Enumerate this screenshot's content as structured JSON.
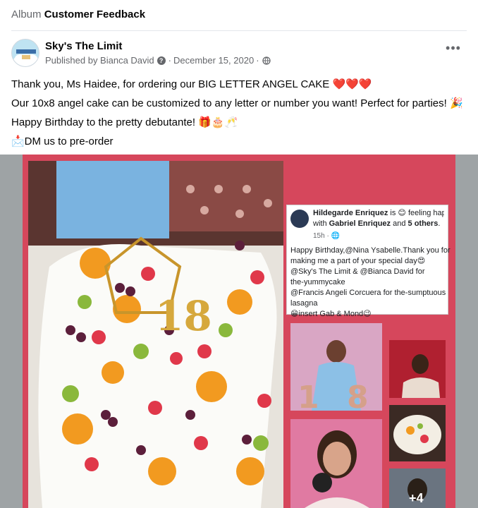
{
  "album": {
    "prefix": "Album",
    "name": "Customer Feedback"
  },
  "post": {
    "page_name": "Sky's The Limit",
    "published_by": "Published by Bianca David",
    "separator": "·",
    "date": "December 15, 2020",
    "more_icon": "•••",
    "lines": [
      "Thank you, Ms Haidee, for ordering our BIG LETTER ANGEL CAKE ❤️❤️❤️",
      "Our 10x8 angel cake can be customized to any letter or number you want! Perfect for parties! 🎉",
      "Happy Birthday to the pretty debutante! 🎁🎂🥂",
      "📩DM us to pre-order"
    ]
  },
  "photo": {
    "card": {
      "author": "Hildegarde Enriquez",
      "is_text": " is 😊 feeling happy",
      "with_text": "with ",
      "with_name": "Gabriel Enriquez",
      "and_text": " and ",
      "others": "5 others",
      "period": ".",
      "time": "15h · 🌐",
      "lines": [
        "Happy Birthday,@Nina Ysabelle.Thank you for",
        "making me a part of your special day😍",
        "@Sky's The Limit & @Bianca David for",
        "the-yummycake",
        "@Francis Angeli Corcuera for the-sumptuous",
        "lasagna",
        "😁insert Gab & Mond😉"
      ]
    },
    "more_photos": "+4"
  },
  "colors": {
    "frame": "#d6475c",
    "link": "#385898",
    "muted": "#65676b"
  }
}
